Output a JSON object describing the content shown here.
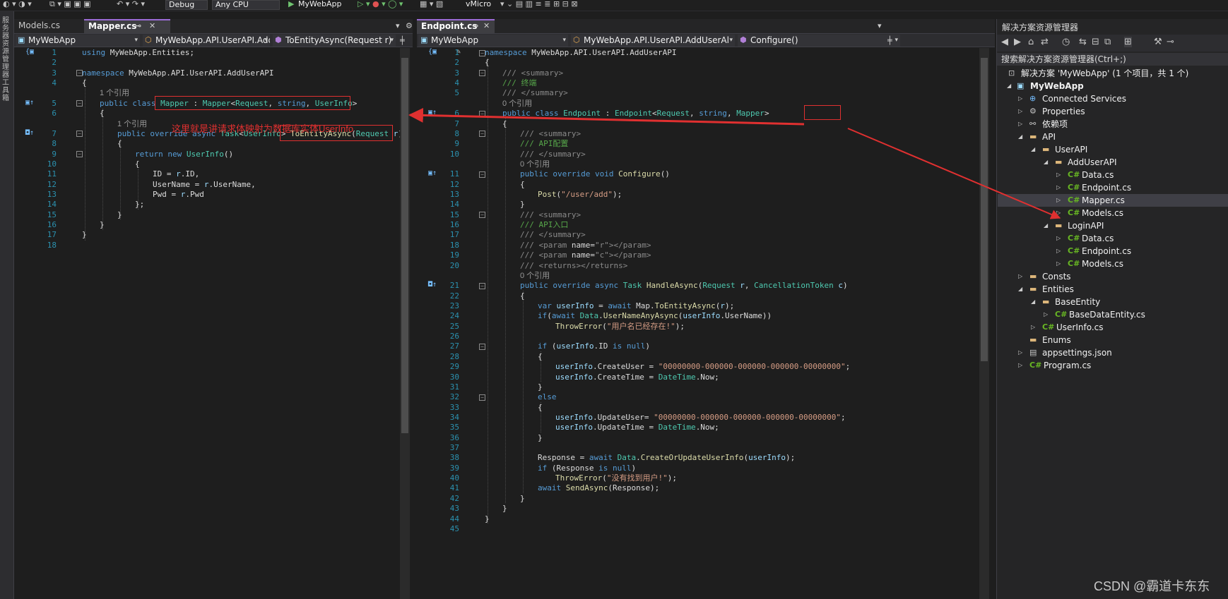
{
  "toolbar": {
    "config": "Debug",
    "platform": "Any CPU",
    "run_target": "MyWebApp",
    "vmicro": "vMicro"
  },
  "left_strip": {
    "text": "服务器资源管理器 工具箱"
  },
  "left_pane": {
    "tabs": [
      {
        "label": "Models.cs"
      },
      {
        "label": "Mapper.cs"
      }
    ],
    "nav": {
      "project": "MyWebApp",
      "type": "MyWebApp.API.UserAPI.Add",
      "member": "ToEntityAsync(Request r)"
    },
    "ref_one": "1 个引用",
    "ref_two": "1 个引用",
    "annotation": "这里就是讲请求体映射为数据库实体UserInfo"
  },
  "right_pane": {
    "tabs": [
      {
        "label": "Endpoint.cs"
      }
    ],
    "nav": {
      "project": "MyWebApp",
      "type": "MyWebApp.API.UserAPI.AddUserAl",
      "member": "Configure()"
    },
    "ref_zero_a": "0 个引用",
    "ref_zero_b": "0 个引用",
    "ref_zero_c": "0 个引用"
  },
  "solution_explorer": {
    "title": "解决方案资源管理器",
    "search_placeholder": "搜索解决方案资源管理器(Ctrl+;)",
    "items": [
      {
        "label": "解决方案 'MyWebApp' (1 个项目，共 1 个)",
        "icon": "solution-icon"
      },
      {
        "label": "MyWebApp",
        "icon": "project-icon"
      },
      {
        "label": "Connected Services",
        "icon": "connected-services-icon"
      },
      {
        "label": "Properties",
        "icon": "properties-icon"
      },
      {
        "label": "依赖项",
        "icon": "dependencies-icon"
      },
      {
        "label": "API",
        "icon": "folder-icon"
      },
      {
        "label": "UserAPI",
        "icon": "folder-icon"
      },
      {
        "label": "AddUserAPI",
        "icon": "folder-icon"
      },
      {
        "label": "Data.cs",
        "icon": "csharp-file-icon"
      },
      {
        "label": "Endpoint.cs",
        "icon": "csharp-file-icon"
      },
      {
        "label": "Mapper.cs",
        "icon": "csharp-file-icon"
      },
      {
        "label": "Models.cs",
        "icon": "csharp-file-icon"
      },
      {
        "label": "LoginAPI",
        "icon": "folder-icon"
      },
      {
        "label": "Data.cs",
        "icon": "csharp-file-icon"
      },
      {
        "label": "Endpoint.cs",
        "icon": "csharp-file-icon"
      },
      {
        "label": "Models.cs",
        "icon": "csharp-file-icon"
      },
      {
        "label": "Consts",
        "icon": "folder-icon"
      },
      {
        "label": "Entities",
        "icon": "folder-icon"
      },
      {
        "label": "BaseEntity",
        "icon": "folder-icon"
      },
      {
        "label": "BaseDataEntity.cs",
        "icon": "csharp-file-icon"
      },
      {
        "label": "UserInfo.cs",
        "icon": "csharp-file-icon"
      },
      {
        "label": "Enums",
        "icon": "folder-icon"
      },
      {
        "label": "appsettings.json",
        "icon": "json-file-icon"
      },
      {
        "label": "Program.cs",
        "icon": "csharp-file-icon"
      }
    ]
  },
  "watermark": "CSDN @霸道卡东东",
  "accent": "#9b6bd6",
  "annotation_color": "#e03030"
}
